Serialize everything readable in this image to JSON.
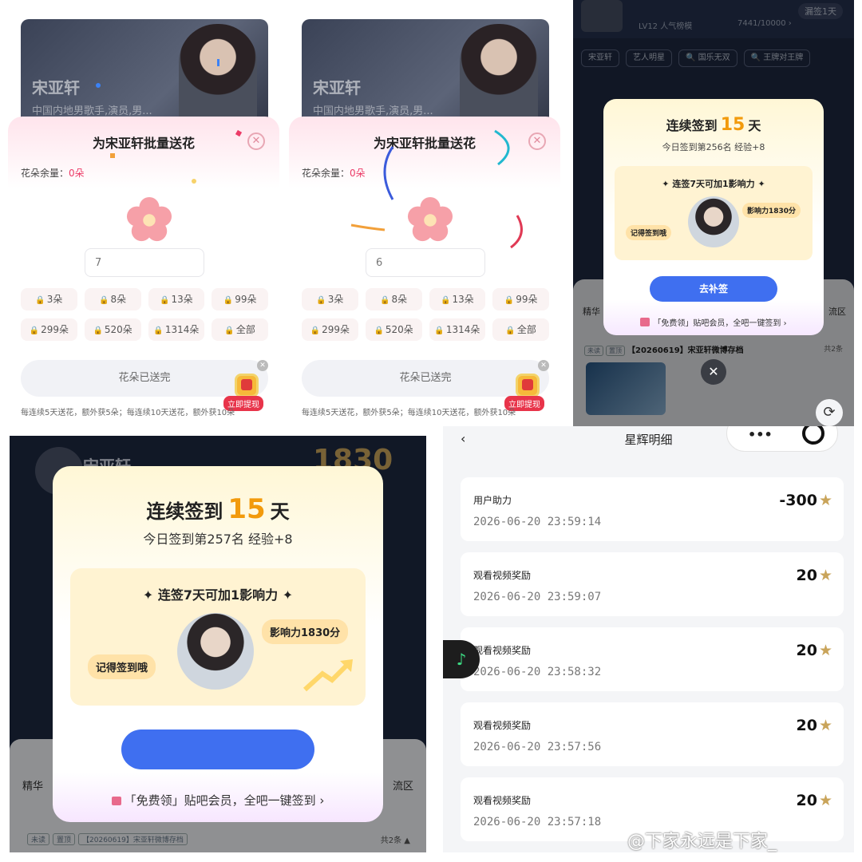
{
  "flower_panels": [
    {
      "hero_name": "宋亚轩",
      "hero_desc": "中国内地男歌手,演员,男...",
      "title": "为宋亚轩批量送花",
      "remain_label": "花朵余量：",
      "remain_value": "0朵",
      "qty_value": "7",
      "chips": [
        "3朵",
        "8朵",
        "13朵",
        "99朵",
        "299朵",
        "520朵",
        "1314朵",
        "全部"
      ],
      "done_label": "花朵已送完",
      "cash_label": "立即提现",
      "tip": "每连续5天送花，额外获5朵；每连续10天送花，额外获10朵"
    },
    {
      "hero_name": "宋亚轩",
      "hero_desc": "中国内地男歌手,演员,男...",
      "title": "为宋亚轩批量送花",
      "remain_label": "花朵余量：",
      "remain_value": "0朵",
      "qty_value": "6",
      "chips": [
        "3朵",
        "8朵",
        "13朵",
        "99朵",
        "299朵",
        "520朵",
        "1314朵",
        "全部"
      ],
      "done_label": "花朵已送完",
      "cash_label": "立即提现",
      "tip": "每连续5天送花，额外获5朵；每连续10天送花，额外获10朵"
    }
  ],
  "signin_small": {
    "level": "LV12 人气榜模",
    "progress": "7441/10000 ›",
    "pill": "漏签1天",
    "tags": [
      "宋亚轩",
      "艺人明星",
      "国乐无双",
      "王牌对王牌"
    ],
    "head_prefix": "连续签到",
    "days": "15",
    "head_suffix": "天",
    "sub": "今日签到第256名 经验+8",
    "box_title": "连签7天可加1影响力",
    "bubble_left": "记得签到哦",
    "bubble_right": "影响力1830分",
    "button": "去补签",
    "foot": "「免费领」贴吧会员，全吧一键签到 ›",
    "jinghua": "精华",
    "liuyan": "流区",
    "post_tags": [
      "未读",
      "置顶"
    ],
    "post_title": "【20260619】宋亚轩微博存档",
    "post_more": "共2条"
  },
  "signin_large": {
    "bg_name": "宋亚轩",
    "bg_score": "1830",
    "head_prefix": "连续签到",
    "days": "15",
    "head_suffix": "天",
    "sub": "今日签到第257名 经验+8",
    "box_title": "连签7天可加1影响力",
    "bubble_left": "记得签到哦",
    "bubble_right": "影响力1830分",
    "foot": "「免费领」贴吧会员，全吧一键签到 ›",
    "jinghua": "精华",
    "liuyan": "流区",
    "post_tags": [
      "未读",
      "置顶"
    ],
    "post_title": "【20260619】宋亚轩微博存档",
    "post_more": "共2条"
  },
  "star_detail": {
    "title": "星辉明细",
    "rows": [
      {
        "label": "用户助力",
        "time": "2026-06-20 23:59:14",
        "value": "-300"
      },
      {
        "label": "观看视频奖励",
        "time": "2026-06-20 23:59:07",
        "value": "20"
      },
      {
        "label": "观看视频奖励",
        "time": "2026-06-20 23:58:32",
        "value": "20"
      },
      {
        "label": "观看视频奖励",
        "time": "2026-06-20 23:57:56",
        "value": "20"
      },
      {
        "label": "观看视频奖励",
        "time": "2026-06-20 23:57:18",
        "value": "20"
      }
    ],
    "star_glyph": "★"
  },
  "watermark": "@下家永远是下家_",
  "colors": {
    "accent_blue": "#3f6ff0",
    "gold": "#f29a0c",
    "pink": "#ec3b67",
    "star": "#c9a45a"
  }
}
